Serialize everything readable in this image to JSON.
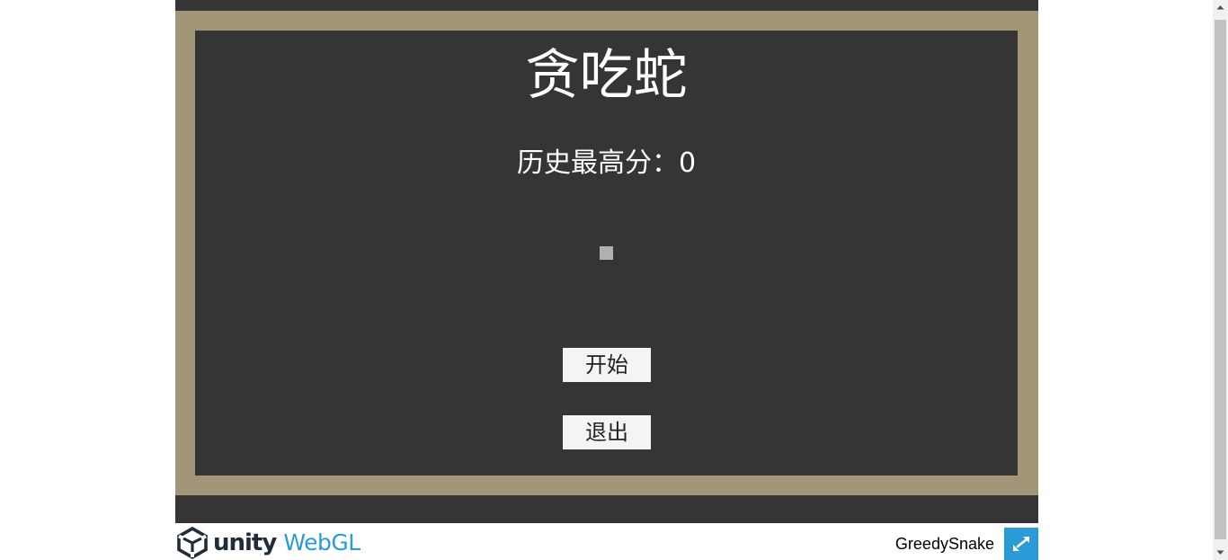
{
  "game": {
    "title": "贪吃蛇",
    "high_score_label": "历史最高分：",
    "high_score_value": "0",
    "start_label": "开始",
    "quit_label": "退出"
  },
  "footer": {
    "brand": "unity",
    "product": "WebGL",
    "game_name": "GreedySnake"
  },
  "icons": {
    "logo": "unity-cube-icon",
    "fullscreen": "fullscreen-expand-icon",
    "scroll_up": "scroll-up-arrow-icon",
    "scroll_down": "scroll-down-arrow-icon"
  },
  "colors": {
    "canvas_bg": "#353535",
    "frame": "#a39577",
    "accent": "#2a9bd6",
    "button_bg": "#f4f4f4"
  }
}
